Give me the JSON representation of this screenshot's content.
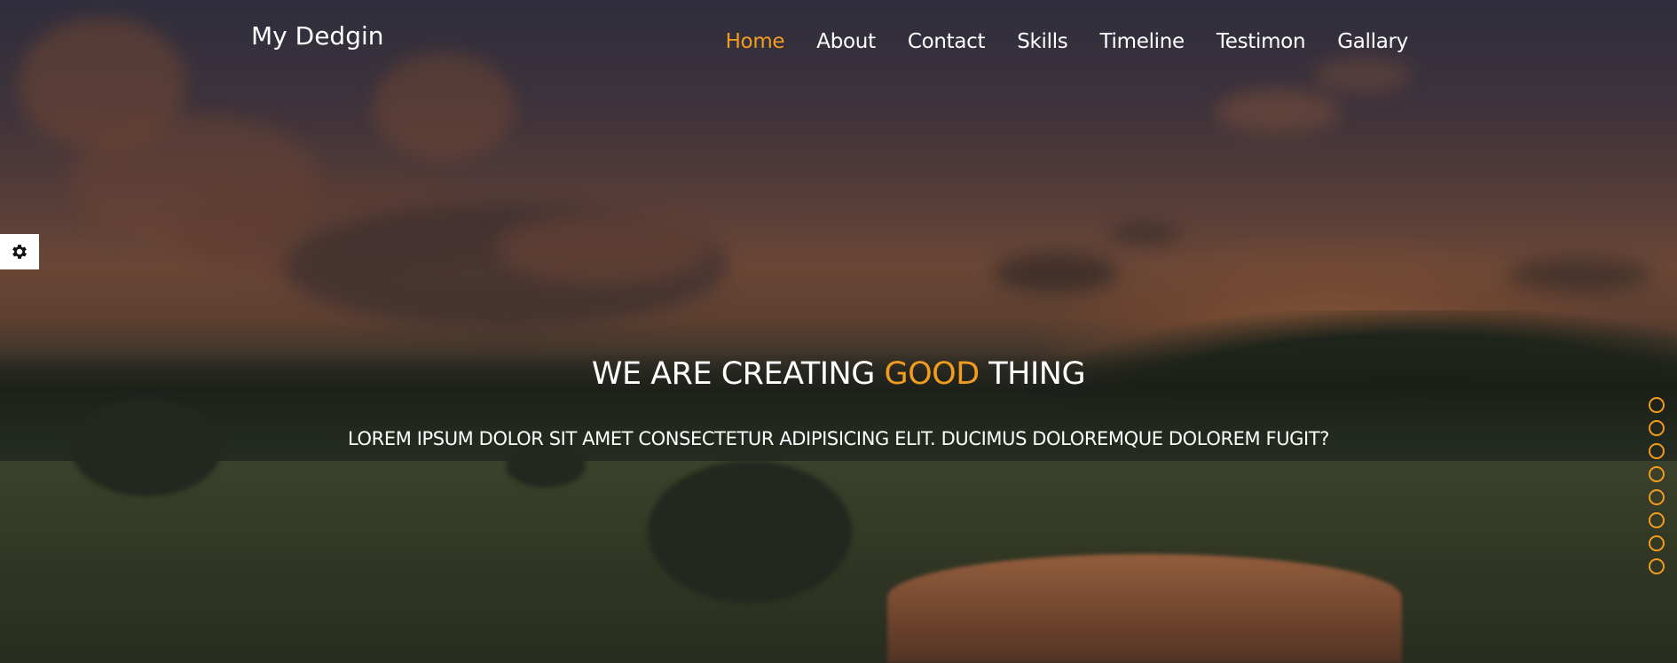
{
  "brand": {
    "name": "My Dedgin"
  },
  "nav": {
    "items": [
      {
        "label": "Home",
        "active": true
      },
      {
        "label": "About",
        "active": false
      },
      {
        "label": "Contact",
        "active": false
      },
      {
        "label": "Skills",
        "active": false
      },
      {
        "label": "Timeline",
        "active": false
      },
      {
        "label": "Testimon",
        "active": false
      },
      {
        "label": "Gallary",
        "active": false
      }
    ]
  },
  "hero": {
    "headline_pre": "WE ARE CREATING",
    "headline_accent": "GOOD",
    "headline_post": "THING",
    "subline": "LOREM IPSUM DOLOR SIT AMET CONSECTETUR ADIPISICING ELIT. DUCIMUS DOLOREMQUE DOLOREM FUGIT?"
  },
  "settings": {
    "icon": "gear-icon"
  },
  "bullets": {
    "count": 8
  },
  "colors": {
    "accent": "#f29c1f",
    "text": "#ffffff",
    "settings_bg": "#ffffff"
  }
}
